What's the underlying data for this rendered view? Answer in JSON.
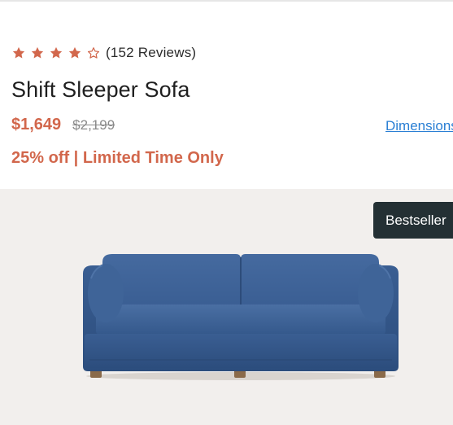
{
  "product": {
    "rating": {
      "stars_filled": 4,
      "stars_total": 5,
      "reviews_text": "(152 Reviews)"
    },
    "title": "Shift Sleeper Sofa",
    "price": "$1,649",
    "original_price": "$2,199",
    "dimensions_link": "Dimensions",
    "promo": "25% off | Limited Time Only"
  },
  "hero": {
    "badge": "Bestseller",
    "image": "blue-sleeper-sofa"
  },
  "colors": {
    "accent": "#d2674c",
    "link": "#2a7fd4",
    "badge_bg": "#243034",
    "sofa": "#3b5f93",
    "hero_bg": "#f2efed"
  }
}
